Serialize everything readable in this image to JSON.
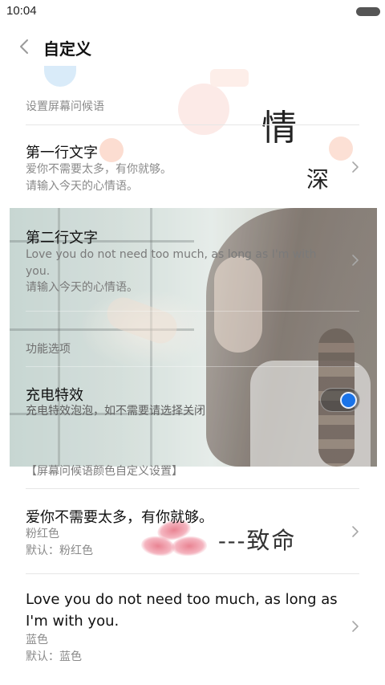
{
  "status_bar": {
    "time": "10:04"
  },
  "header": {
    "title": "自定义"
  },
  "greeting_section": {
    "label": "设置屏幕问候语",
    "line1": {
      "title": "第一行文字",
      "value": "爱你不需要太多，有你就够。",
      "hint": "请输入今天的心情语。"
    },
    "line2": {
      "title": "第二行文字",
      "value_line1": "Love you do not need too much, as long as I'm with",
      "value_line2": "you.",
      "hint": "请输入今天的心情语。"
    }
  },
  "function_section": {
    "label": "功能选项",
    "charging": {
      "title": "充电特效",
      "desc": "充电特效泡泡，如不需要请选择关闭",
      "enabled": true
    }
  },
  "color_section": {
    "label": "【屏幕问候语颜色自定义设置】",
    "line1": {
      "title": "爱你不需要太多，有你就够。",
      "color_name": "粉红色",
      "default": "默认：粉红色"
    },
    "line2": {
      "title_line1": "Love you do not need too much, as long as",
      "title_line2": "I'm with you.",
      "color_name": "蓝色",
      "default": "默认：蓝色"
    }
  },
  "decor": {
    "calligraphy_1": "情",
    "calligraphy_2": "深",
    "signature": "---致命"
  },
  "colors": {
    "accent": "#1a73e8",
    "text_secondary": "#8a8a8a",
    "divider": "#e6e6e6"
  }
}
